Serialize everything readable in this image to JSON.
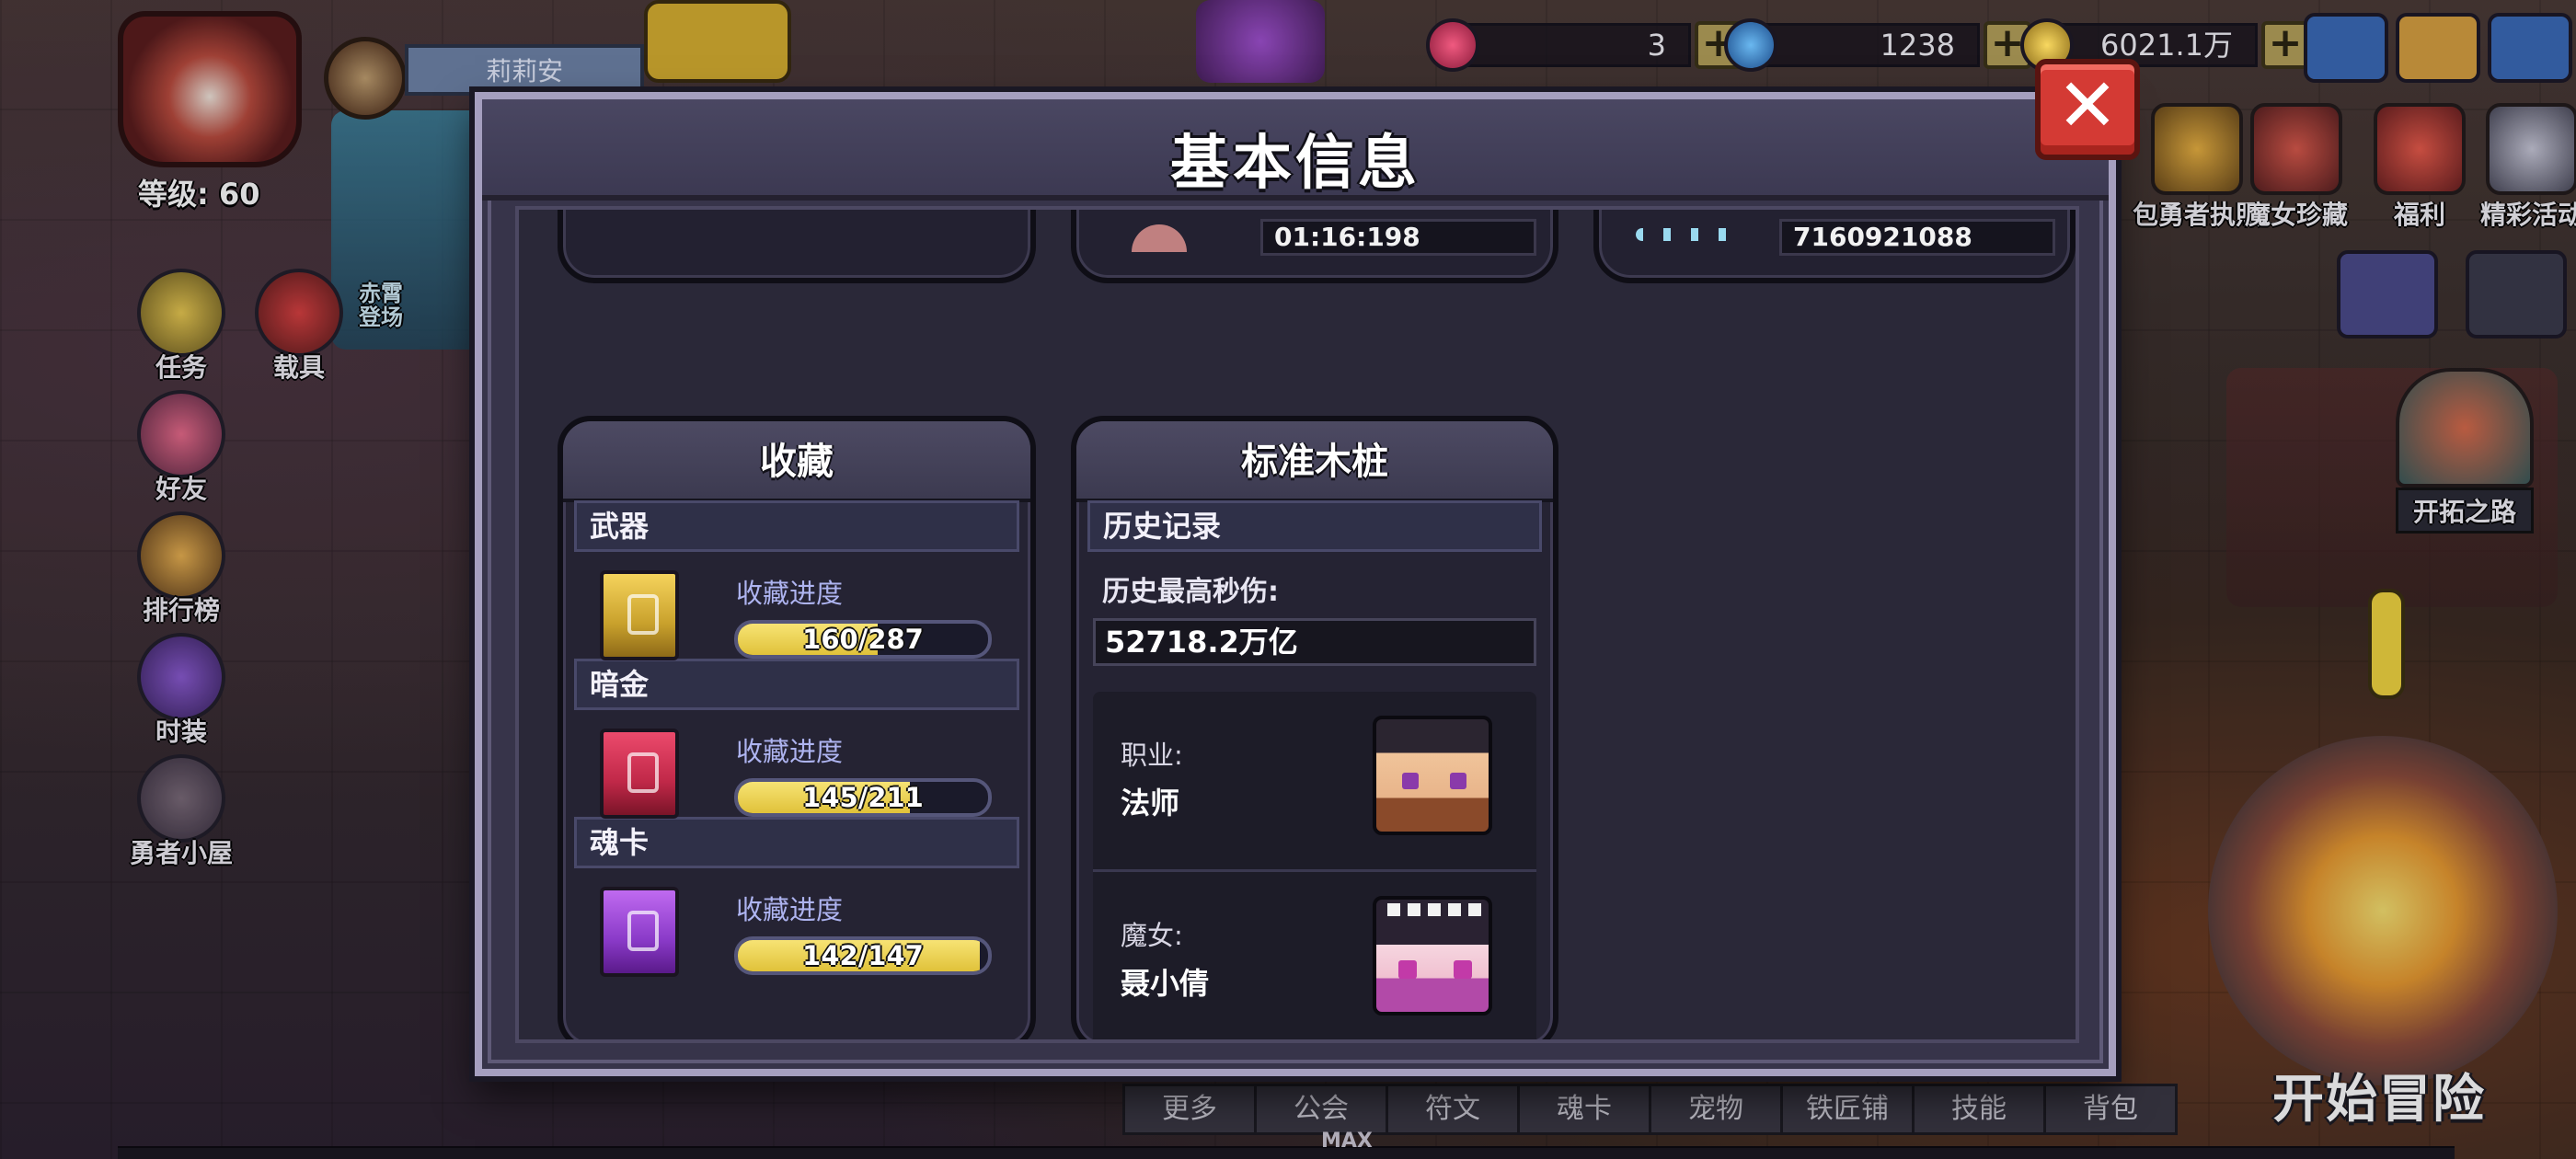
{
  "player": {
    "name": "莉莉安",
    "level": "等级: 60"
  },
  "currencies": [
    {
      "value": "3",
      "icon": "gem-icon",
      "color": "#c8305c"
    },
    {
      "value": "1238",
      "icon": "diamond-icon",
      "color": "#3a8cd8"
    },
    {
      "value": "6021.1万",
      "icon": "coin-icon",
      "color": "#d8a830"
    }
  ],
  "plus_label": "+",
  "left_menu": [
    {
      "label": "任务",
      "icon": "quest-icon"
    },
    {
      "label": "载具",
      "icon": "vehicle-icon"
    },
    {
      "label": "好友",
      "icon": "friends-icon"
    },
    {
      "label": "排行榜",
      "icon": "trophy-icon"
    },
    {
      "label": "时装",
      "icon": "costume-icon"
    },
    {
      "label": "勇者小屋",
      "icon": "house-icon"
    }
  ],
  "scene_event_label": "赤霄\n登场",
  "right_menu": [
    {
      "label": "包勇者执照",
      "icon": "license-icon"
    },
    {
      "label": "魔女珍藏",
      "icon": "witch-treasure-icon"
    },
    {
      "label": "福利",
      "icon": "gift-icon"
    },
    {
      "label": "精彩活动",
      "icon": "event-icon"
    }
  ],
  "pioneer_road": "开拓之路",
  "bottom_tabs": [
    "更多",
    "公会",
    "符文",
    "魂卡",
    "宠物",
    "铁匠铺",
    "技能",
    "背包"
  ],
  "max_label": "MAX",
  "start_adventure": "开始冒险",
  "modal": {
    "title": "基本信息",
    "close_label": "✕",
    "top_cards": {
      "time_value": "01:16:198",
      "id_value": "7160921088"
    },
    "collection": {
      "title": "收藏",
      "progress_label": "收藏进度",
      "items": [
        {
          "name": "武器",
          "progress": "160/287",
          "current": 160,
          "total": 287,
          "color": "#f5d35c"
        },
        {
          "name": "暗金",
          "progress": "145/211",
          "current": 145,
          "total": 211,
          "color": "#ec4a6c"
        },
        {
          "name": "魂卡",
          "progress": "142/147",
          "current": 142,
          "total": 147,
          "color": "#c06af0"
        }
      ]
    },
    "dummy": {
      "title": "标准木桩",
      "history_header": "历史记录",
      "max_dps_label": "历史最高秒伤:",
      "max_dps_value": "52718.2万亿",
      "class_label": "职业:",
      "class_value": "法师",
      "witch_label": "魔女:",
      "witch_value": "聂小倩"
    }
  }
}
